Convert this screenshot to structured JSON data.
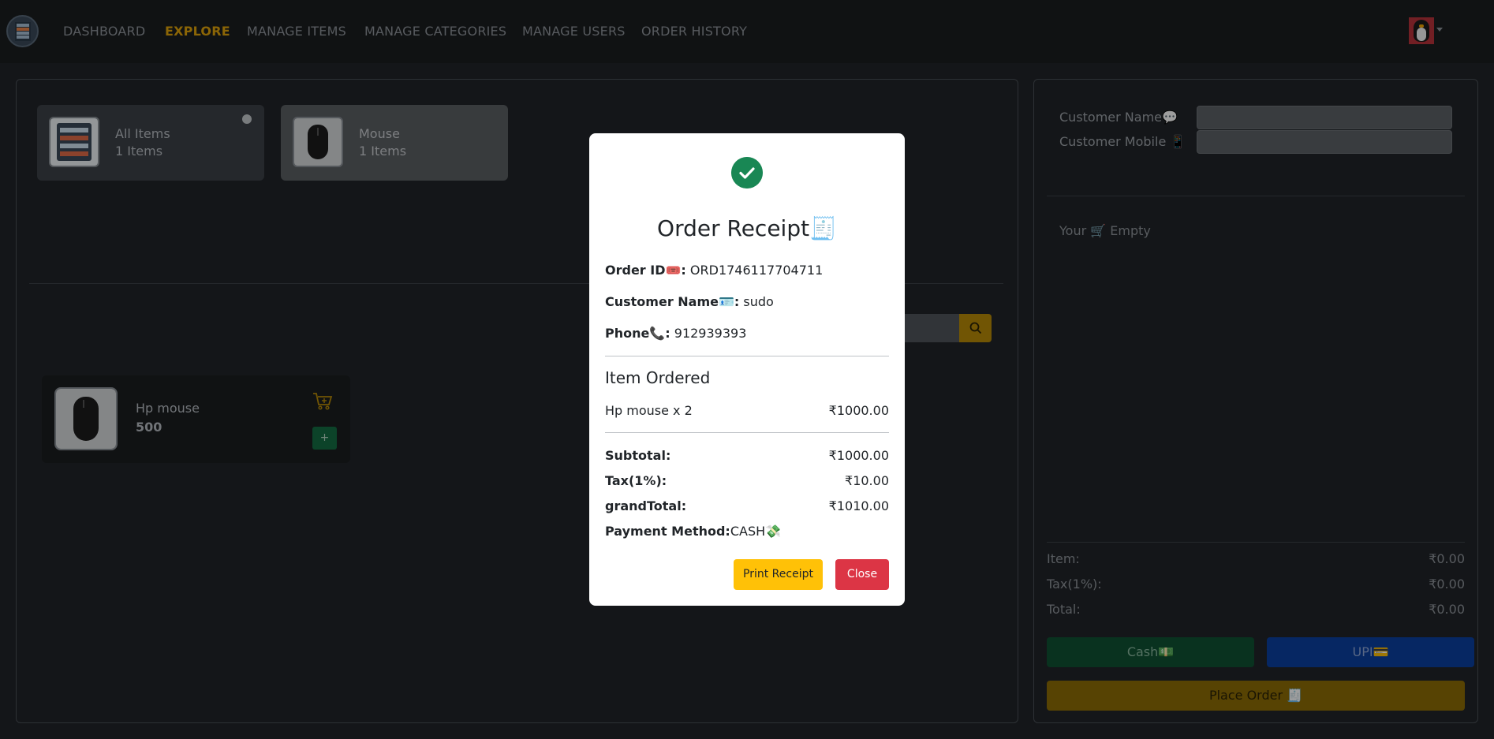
{
  "nav": {
    "links": [
      "DASHBOARD",
      "EXPLORE",
      "MANAGE ITEMS",
      "MANAGE CATEGORIES",
      "MANAGE USERS",
      "ORDER HISTORY"
    ],
    "active": "EXPLORE"
  },
  "categories": [
    {
      "name": "All Items",
      "count": "1 Items",
      "icon": "server-rack-icon",
      "selected": true
    },
    {
      "name": "Mouse",
      "count": "1 Items",
      "icon": "mouse-icon",
      "selected": false
    }
  ],
  "items": [
    {
      "name": "Hp mouse",
      "price": "500",
      "add_label": "+"
    }
  ],
  "customer_form": {
    "name_label": "Customer Name💬",
    "mobile_label": "Customer Mobile 📱",
    "name_value": "",
    "mobile_value": ""
  },
  "cart": {
    "empty_text": "Your 🛒 Empty",
    "item_label": "Item:",
    "item_value": "₹0.00",
    "tax_label": "Tax(1%):",
    "tax_value": "₹0.00",
    "total_label": "Total:",
    "total_value": "₹0.00",
    "cash_label": "Cash💵",
    "upi_label": "UPI💳",
    "place_order_label": "Place Order 🧾"
  },
  "receipt": {
    "title": "Order Receipt🧾",
    "order_id_label": "Order ID🎟️:",
    "order_id": "ORD1746117704711",
    "customer_label": "Customer Name🪪:",
    "customer_name": "sudo",
    "phone_label": "Phone📞:",
    "phone": "912939393",
    "items_heading": "Item Ordered",
    "lines": [
      {
        "desc": "Hp mouse x 2",
        "amount": "₹1000.00"
      }
    ],
    "subtotal_label": "Subtotal:",
    "subtotal": "₹1000.00",
    "tax_label": "Tax(1%):",
    "tax": "₹10.00",
    "grand_label": "grandTotal:",
    "grand_total": "₹1010.00",
    "payment_label": "Payment Method:",
    "payment_method": "CASH💸",
    "print_label": "Print Receipt",
    "close_label": "Close"
  },
  "colors": {
    "accent": "#e0a30a",
    "success": "#198754",
    "danger": "#dc3545",
    "warning": "#ffc107"
  }
}
